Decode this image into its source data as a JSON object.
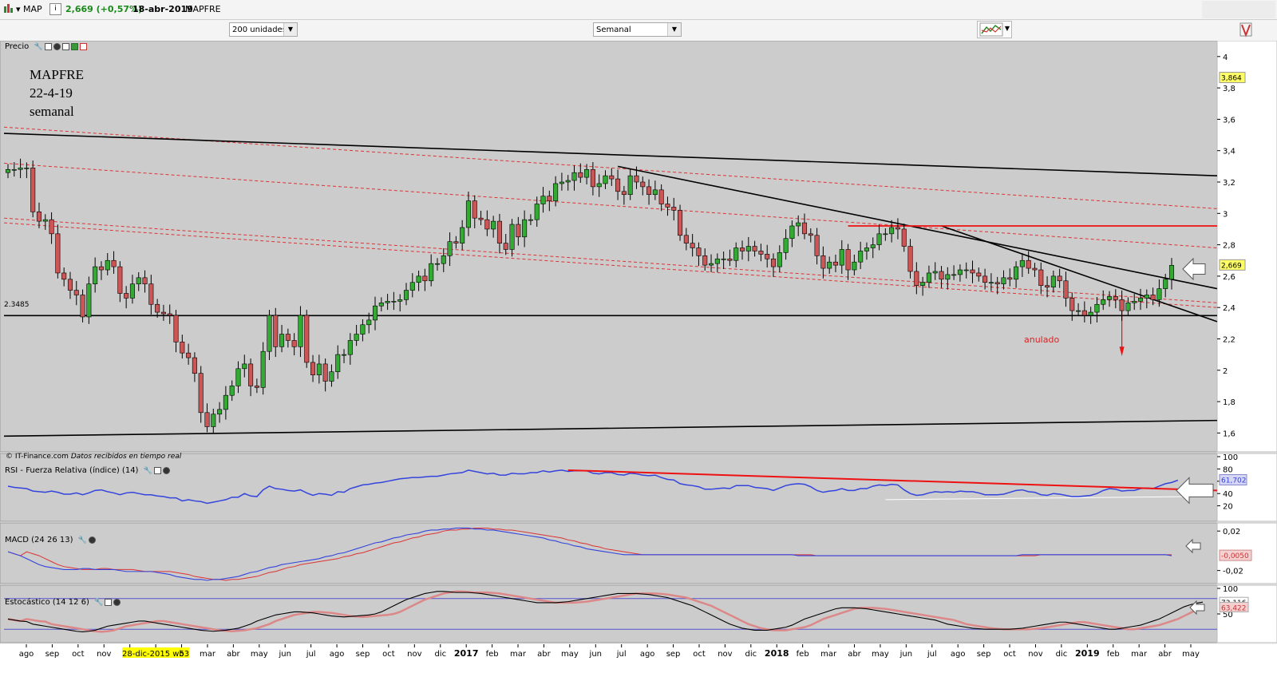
{
  "topbar": {
    "symbol": "MAP",
    "price_change": "2,669 (+0,57%)",
    "date": "18-abr-2019",
    "name": "MAPFRE"
  },
  "toolbar": {
    "units_select": "200 unidades",
    "period_select": "Semanal"
  },
  "annotation": {
    "title": "MAPFRE",
    "date": "22-4-19",
    "period": "semanal",
    "cancel_label": "anulado",
    "credit": "© IT-Finance.com",
    "credit_note": "Datos recibidos en tiempo real",
    "level_label": "2.3485"
  },
  "panels": {
    "price": "Precio",
    "rsi": "RSI - Fuerza Relativa (índice) (14)",
    "macd": "MACD (24 26 13)",
    "stoch": "Estocástico (14 12 6)"
  },
  "colors": {
    "background": "#cccccc",
    "up": "#33aa33",
    "down": "#cc5555",
    "rsi": "#3344dd",
    "signal": "#dd3333",
    "trend": "#000000",
    "resistance": "#ee1111"
  },
  "chart_data": [
    {
      "type": "candlestick",
      "title": "MAPFRE",
      "period": "semanal",
      "x_ticks": [
        "ago",
        "sep",
        "oct",
        "nov",
        "dic",
        "28-dic-2015 w53",
        "b",
        "mar",
        "abr",
        "may",
        "jun",
        "jul",
        "ago",
        "sep",
        "oct",
        "nov",
        "dic",
        "2017",
        "feb",
        "mar",
        "abr",
        "may",
        "jun",
        "jul",
        "ago",
        "sep",
        "oct",
        "nov",
        "dic",
        "2018",
        "feb",
        "mar",
        "abr",
        "may",
        "jun",
        "jul",
        "ago",
        "sep",
        "oct",
        "nov",
        "dic",
        "2019",
        "feb",
        "mar",
        "abr",
        "may"
      ],
      "ylim": [
        1.5,
        4.05
      ],
      "y_ticks": [
        "4",
        "3,8",
        "3,6",
        "3,4",
        "3,2",
        "3",
        "2,8",
        "2,6",
        "2,4",
        "2,2",
        "2",
        "1,8",
        "1,6"
      ],
      "price_badges": [
        "3,864",
        "2,669"
      ],
      "close": [
        3.28,
        3.28,
        3.29,
        3.29,
        3.01,
        2.95,
        2.96,
        2.87,
        2.62,
        2.58,
        2.51,
        2.48,
        2.34,
        2.55,
        2.66,
        2.64,
        2.7,
        2.66,
        2.49,
        2.46,
        2.55,
        2.59,
        2.55,
        2.42,
        2.37,
        2.36,
        2.35,
        2.18,
        2.11,
        2.08,
        1.98,
        1.73,
        1.64,
        1.72,
        1.75,
        1.84,
        1.9,
        2.01,
        2.04,
        1.9,
        1.89,
        2.12,
        2.35,
        2.15,
        2.23,
        2.19,
        2.15,
        2.35,
        2.05,
        1.97,
        2.04,
        1.93,
        1.99,
        2.1,
        2.1,
        2.19,
        2.23,
        2.29,
        2.32,
        2.41,
        2.43,
        2.44,
        2.44,
        2.45,
        2.51,
        2.56,
        2.6,
        2.57,
        2.68,
        2.68,
        2.73,
        2.82,
        2.81,
        2.91,
        3.08,
        2.97,
        2.96,
        2.9,
        2.95,
        2.81,
        2.77,
        2.93,
        2.85,
        2.96,
        2.96,
        3.06,
        3.11,
        3.08,
        3.19,
        3.2,
        3.21,
        3.26,
        3.23,
        3.28,
        3.17,
        3.19,
        3.24,
        3.22,
        3.14,
        3.12,
        3.24,
        3.2,
        3.17,
        3.12,
        3.15,
        3.06,
        3.04,
        3.02,
        2.86,
        2.81,
        2.78,
        2.73,
        2.67,
        2.68,
        2.71,
        2.71,
        2.7,
        2.78,
        2.76,
        2.79,
        2.76,
        2.74,
        2.71,
        2.66,
        2.75,
        2.84,
        2.92,
        2.94,
        2.87,
        2.86,
        2.73,
        2.65,
        2.69,
        2.67,
        2.77,
        2.64,
        2.69,
        2.76,
        2.78,
        2.8,
        2.87,
        2.87,
        2.91,
        2.9,
        2.79,
        2.63,
        2.54,
        2.56,
        2.62,
        2.63,
        2.58,
        2.61,
        2.61,
        2.64,
        2.64,
        2.62,
        2.6,
        2.56,
        2.56,
        2.55,
        2.59,
        2.58,
        2.66,
        2.7,
        2.65,
        2.64,
        2.54,
        2.53,
        2.6,
        2.57,
        2.46,
        2.38,
        2.38,
        2.35,
        2.37,
        2.42,
        2.45,
        2.47,
        2.45,
        2.38,
        2.43,
        2.44,
        2.46,
        2.48,
        2.45,
        2.52,
        2.58,
        2.669
      ],
      "series": [
        {
          "name": "RSI",
          "ylim": [
            0,
            100
          ],
          "y_ticks": [
            "100",
            "80",
            "60",
            "40",
            "20"
          ],
          "badge": "61,702",
          "values": [
            52,
            50,
            49,
            48,
            44,
            43,
            42,
            44,
            42,
            39,
            39,
            41,
            38,
            41,
            45,
            46,
            43,
            41,
            38,
            41,
            42,
            40,
            38,
            38,
            36,
            35,
            33,
            33,
            28,
            30,
            28,
            27,
            24,
            26,
            28,
            30,
            34,
            34,
            40,
            36,
            35,
            46,
            52,
            48,
            47,
            45,
            44,
            46,
            41,
            37,
            40,
            39,
            37,
            43,
            42,
            48,
            51,
            54,
            55,
            57,
            58,
            60,
            62,
            64,
            65,
            66,
            66,
            67,
            68,
            68,
            70,
            72,
            73,
            74,
            78,
            76,
            74,
            72,
            73,
            70,
            70,
            73,
            72,
            72,
            74,
            74,
            77,
            75,
            77,
            78,
            76,
            77,
            77,
            77,
            73,
            72,
            74,
            74,
            71,
            70,
            73,
            72,
            70,
            69,
            70,
            66,
            63,
            62,
            56,
            54,
            53,
            51,
            47,
            47,
            48,
            49,
            48,
            53,
            53,
            53,
            50,
            49,
            48,
            45,
            49,
            53,
            55,
            56,
            55,
            51,
            45,
            42,
            44,
            45,
            48,
            45,
            45,
            48,
            48,
            52,
            54,
            53,
            55,
            54,
            46,
            40,
            37,
            38,
            41,
            43,
            42,
            43,
            42,
            44,
            43,
            43,
            41,
            38,
            38,
            38,
            39,
            42,
            45,
            46,
            43,
            42,
            38,
            37,
            40,
            39,
            37,
            35,
            35,
            36,
            37,
            40,
            45,
            48,
            47,
            44,
            45,
            45,
            48,
            49,
            48,
            52,
            56,
            58,
            61.702
          ]
        },
        {
          "name": "MACD",
          "ylim": [
            -0.03,
            0.025
          ],
          "y_ticks": [
            "0,02",
            "-0,02"
          ],
          "badge": "-0,0050",
          "values": [
            -0.001,
            -0.003,
            -0.005,
            -0.008,
            -0.011,
            -0.014,
            -0.016,
            -0.017,
            -0.018,
            -0.019,
            -0.019,
            -0.019,
            -0.018,
            -0.018,
            -0.019,
            -0.019,
            -0.019,
            -0.019,
            -0.02,
            -0.021,
            -0.021,
            -0.021,
            -0.021,
            -0.021,
            -0.022,
            -0.023,
            -0.024,
            -0.026,
            -0.027,
            -0.028,
            -0.029,
            -0.029,
            -0.03,
            -0.029,
            -0.029,
            -0.028,
            -0.027,
            -0.026,
            -0.024,
            -0.022,
            -0.021,
            -0.019,
            -0.017,
            -0.016,
            -0.014,
            -0.013,
            -0.012,
            -0.011,
            -0.01,
            -0.009,
            -0.008,
            -0.006,
            -0.005,
            -0.003,
            -0.002,
            0,
            0.002,
            0.004,
            0.006,
            0.008,
            0.009,
            0.011,
            0.013,
            0.014,
            0.016,
            0.017,
            0.018,
            0.02,
            0.021,
            0.021,
            0.022,
            0.022,
            0.023,
            0.023,
            0.023,
            0.022,
            0.022,
            0.021,
            0.021,
            0.02,
            0.019,
            0.018,
            0.017,
            0.016,
            0.015,
            0.014,
            0.013,
            0.011,
            0.01,
            0.008,
            0.007,
            0.005,
            0.004,
            0.002,
            0.001,
            0,
            -0.001,
            -0.002,
            -0.003,
            -0.004,
            -0.004,
            -0.004,
            -0.004,
            -0.004,
            -0.004,
            -0.004,
            -0.004,
            -0.004,
            -0.004,
            -0.004,
            -0.004,
            -0.004,
            -0.004,
            -0.004,
            -0.004,
            -0.004,
            -0.004,
            -0.004,
            -0.004,
            -0.004,
            -0.004,
            -0.004,
            -0.004,
            -0.004,
            -0.004,
            -0.004,
            -0.004,
            -0.005,
            -0.005,
            -0.005,
            -0.005,
            -0.005,
            -0.005,
            -0.005,
            -0.005,
            -0.005,
            -0.005,
            -0.005,
            -0.005,
            -0.005,
            -0.005,
            -0.005,
            -0.005,
            -0.005,
            -0.005,
            -0.005,
            -0.005,
            -0.005,
            -0.005,
            -0.005,
            -0.005,
            -0.005,
            -0.005,
            -0.005,
            -0.005,
            -0.005,
            -0.005,
            -0.005,
            -0.005,
            -0.005,
            -0.005,
            -0.005,
            -0.005,
            -0.004,
            -0.004,
            -0.004,
            -0.004,
            -0.004,
            -0.004,
            -0.004,
            -0.004,
            -0.004,
            -0.004,
            -0.004,
            -0.004,
            -0.004,
            -0.004,
            -0.004,
            -0.004,
            -0.004,
            -0.004,
            -0.004,
            -0.004,
            -0.004,
            -0.004,
            -0.004,
            -0.004,
            -0.005
          ]
        },
        {
          "name": "Estocástico",
          "ylim": [
            0,
            100
          ],
          "y_ticks": [
            "100",
            "50"
          ],
          "badges": [
            "73,116",
            "63,422"
          ],
          "values": [
            40,
            38,
            36,
            35,
            30,
            28,
            26,
            24,
            22,
            20,
            18,
            16,
            15,
            16,
            18,
            22,
            26,
            28,
            30,
            32,
            34,
            36,
            36,
            34,
            32,
            30,
            28,
            26,
            24,
            22,
            20,
            18,
            17,
            16,
            17,
            18,
            20,
            22,
            26,
            30,
            36,
            40,
            44,
            48,
            50,
            52,
            54,
            54,
            53,
            52,
            50,
            48,
            46,
            45,
            44,
            45,
            46,
            47,
            48,
            50,
            54,
            60,
            66,
            72,
            78,
            82,
            86,
            90,
            92,
            94,
            94,
            93,
            92,
            92,
            92,
            91,
            90,
            88,
            86,
            84,
            82,
            80,
            78,
            76,
            74,
            72,
            72,
            72,
            72,
            73,
            74,
            76,
            78,
            80,
            82,
            84,
            86,
            88,
            90,
            90,
            90,
            90,
            89,
            88,
            86,
            84,
            82,
            78,
            74,
            70,
            66,
            60,
            54,
            48,
            42,
            36,
            30,
            26,
            22,
            20,
            18,
            18,
            18,
            20,
            22,
            24,
            28,
            34,
            40,
            44,
            48,
            52,
            56,
            60,
            62,
            62,
            62,
            61,
            60,
            58,
            56,
            54,
            52,
            50,
            48,
            46,
            44,
            42,
            40,
            38,
            34,
            30,
            28,
            26,
            24,
            22,
            21,
            20,
            20,
            20,
            20,
            20,
            21,
            22,
            24,
            26,
            28,
            30,
            32,
            34,
            34,
            32,
            30,
            28,
            26,
            24,
            22,
            20,
            20,
            22,
            24,
            26,
            28,
            32,
            36,
            40,
            46,
            52,
            58,
            64,
            68,
            71,
            73.116
          ]
        }
      ]
    }
  ]
}
